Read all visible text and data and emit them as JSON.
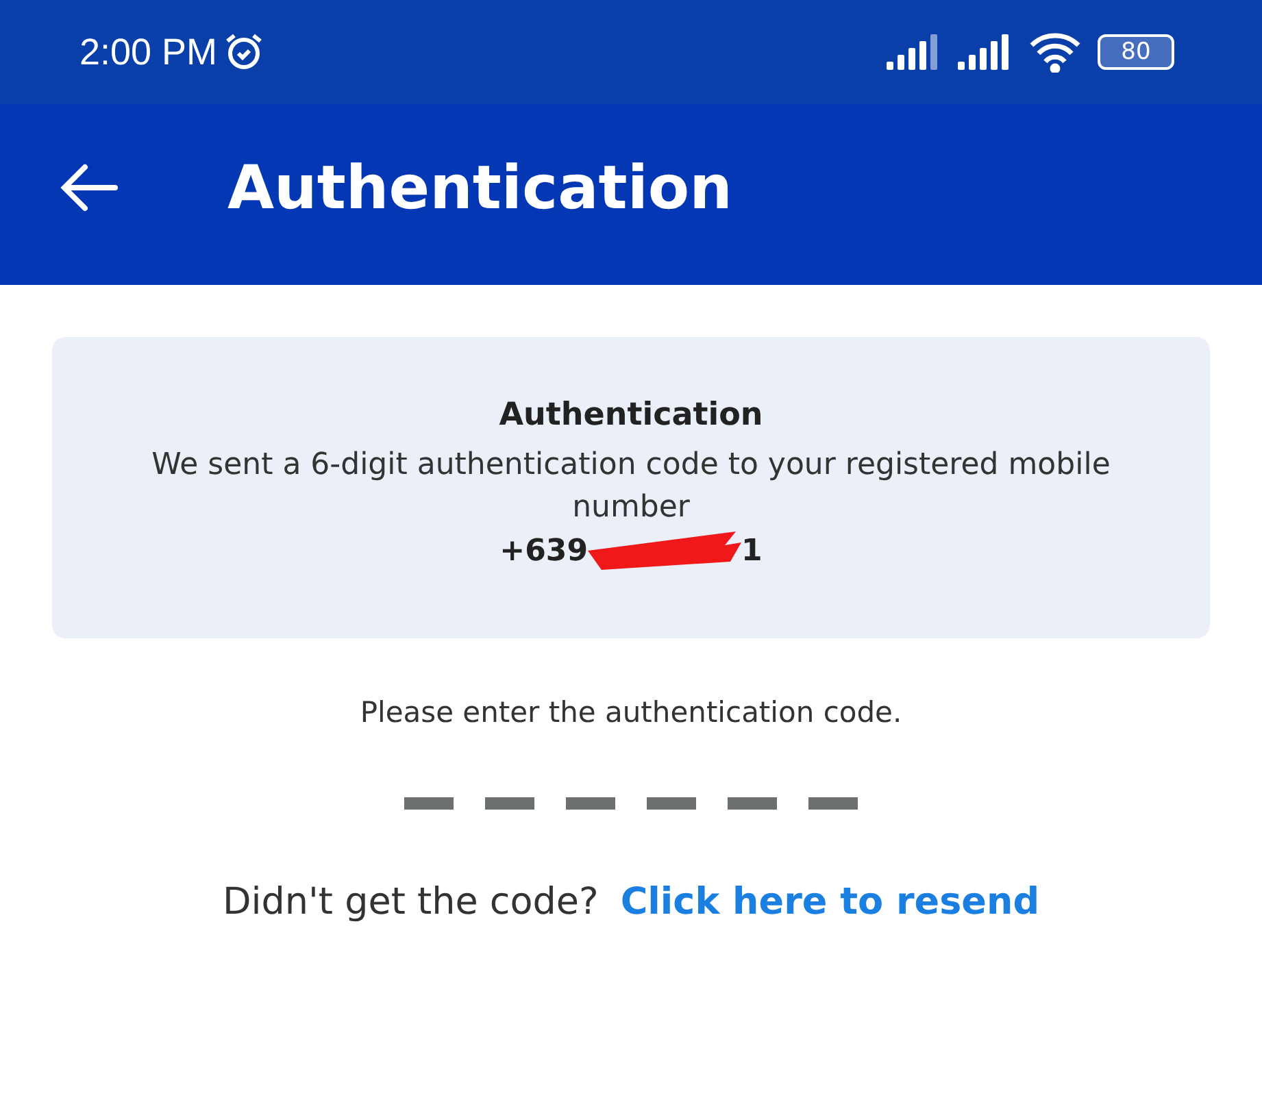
{
  "status_bar": {
    "time": "2:00 PM",
    "battery": "80"
  },
  "app_bar": {
    "title": "Authentication"
  },
  "info_card": {
    "title": "Authentication",
    "message": "We sent a 6-digit authentication code to your registered mobile number",
    "phone_start": "+639",
    "phone_end": "1"
  },
  "prompt": "Please enter the authentication code.",
  "code_slots": [
    {
      "filled": false
    },
    {
      "filled": false
    },
    {
      "filled": false
    },
    {
      "filled": false
    },
    {
      "filled": false
    },
    {
      "filled": false
    }
  ],
  "resend": {
    "question": "Didn't get the code?",
    "link": "Click here to resend"
  }
}
